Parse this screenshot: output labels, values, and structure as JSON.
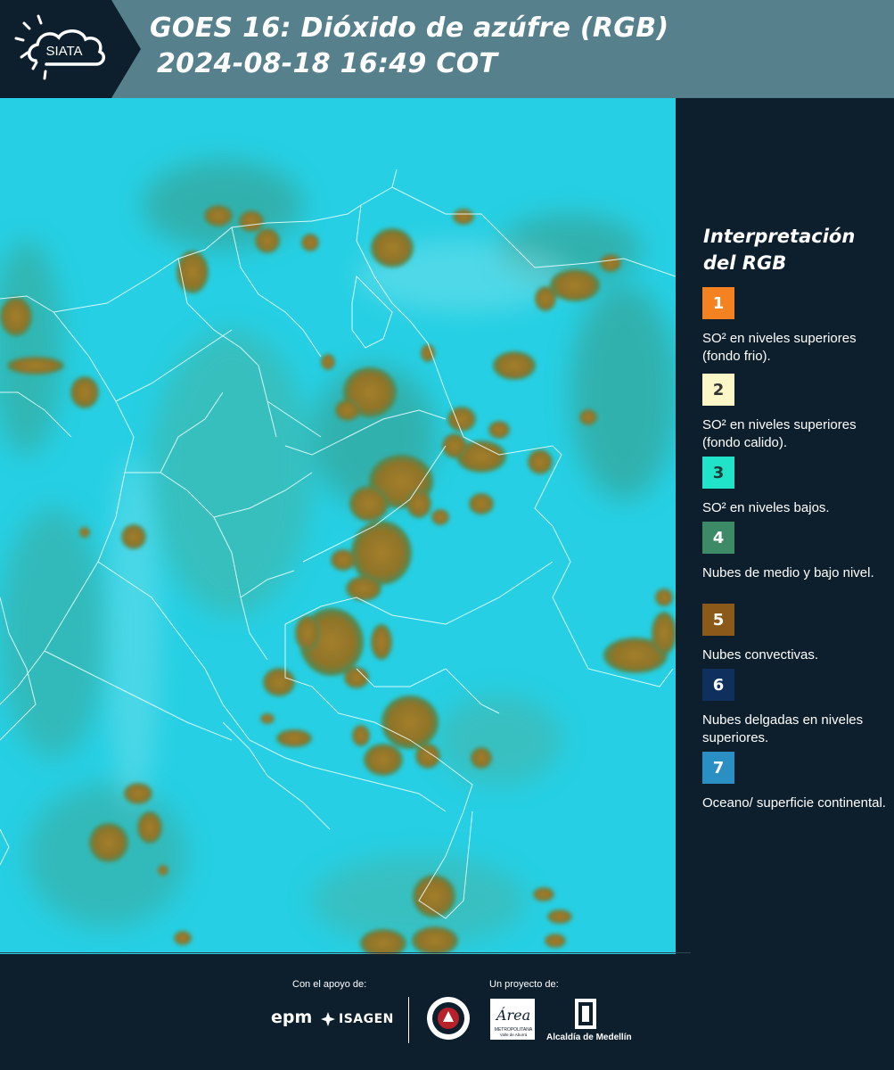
{
  "header": {
    "logo_text": "SIATA",
    "title_line1": "GOES 16: Dióxido de azúfre (RGB)",
    "title_line2": "2024-08-18 16:49 COT",
    "background_color": "#56808c"
  },
  "map": {
    "description_icon": "satellite-rgb-image",
    "background_color": "#25cde1",
    "cloud_color": "#9a7a28",
    "border_color": "#e6ffff"
  },
  "legend": {
    "title": "Interpretación del RGB",
    "items": [
      {
        "number": "1",
        "color": "#f48220",
        "text_color": "#ffffff",
        "label": "SO² en niveles superiores (fondo frio)."
      },
      {
        "number": "2",
        "color": "#fdf7c8",
        "text_color": "#333333",
        "label": "SO² en niveles superiores (fondo calido)."
      },
      {
        "number": "3",
        "color": "#21e3c7",
        "text_color": "#1a3a3a",
        "label": "SO² en niveles bajos."
      },
      {
        "number": "4",
        "color": "#3c8a66",
        "text_color": "#ffffff",
        "label": "Nubes de medio y bajo nivel."
      },
      {
        "number": "5",
        "color": "#8b5a1a",
        "text_color": "#ffffff",
        "label": "Nubes convectivas."
      },
      {
        "number": "6",
        "color": "#0f2f5c",
        "text_color": "#ffffff",
        "label": "Nubes delgadas en niveles superiores."
      },
      {
        "number": "7",
        "color": "#2a8fc2",
        "text_color": "#ffffff",
        "label": "Oceano/ superficie continental."
      }
    ]
  },
  "footer": {
    "support_label": "Con el apoyo de:",
    "project_label": "Un proyecto de:",
    "sponsors": [
      "epm",
      "ISAGEN"
    ],
    "partners": [
      "Área Metropolitana Valle de Aburrá",
      "Alcaldía de Medellín"
    ],
    "alcaldia_label": "Alcaldía de Medellín",
    "epm_label": "epm",
    "isagen_label": "ISAGEN",
    "area_logo_text": "Área",
    "metropolitana_label": "METROPOLITANA",
    "valle_label": "Valle de Aburrá"
  }
}
